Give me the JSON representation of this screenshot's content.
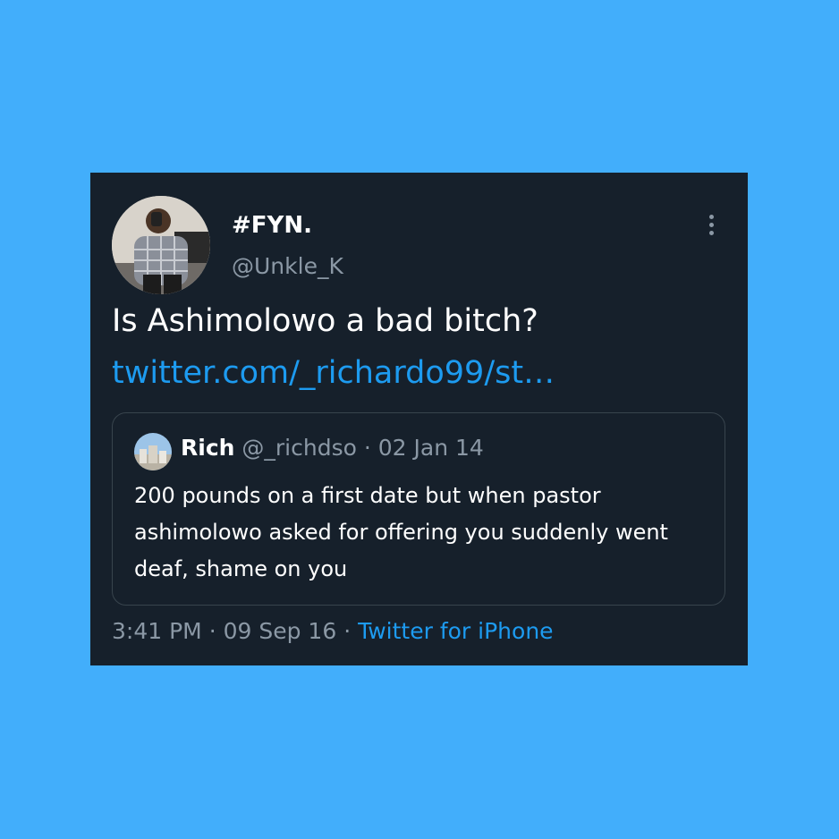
{
  "tweet": {
    "display_name": "#FYN.",
    "handle": "@Unkle_K",
    "text": "Is Ashimolowo a bad bitch?",
    "link": "twitter.com/_richardo99/st…",
    "quote": {
      "name": "Rich",
      "handle": "@_richdso",
      "separator": "·",
      "date": "02 Jan 14",
      "text": "200 pounds on a first date but when pastor ashimolowo asked for offering you suddenly went deaf, shame on you"
    },
    "time": "3:41 PM",
    "separator": "·",
    "date": "09 Sep 16",
    "source": "Twitter for iPhone"
  },
  "colors": {
    "background": "#42aefb",
    "card": "#16202b",
    "text": "#ffffff",
    "secondary": "#8b98a5",
    "link": "#1d9bf0",
    "border": "#38444d"
  },
  "icons": {
    "avatar": "avatar-photo",
    "more": "more-vertical-icon"
  }
}
